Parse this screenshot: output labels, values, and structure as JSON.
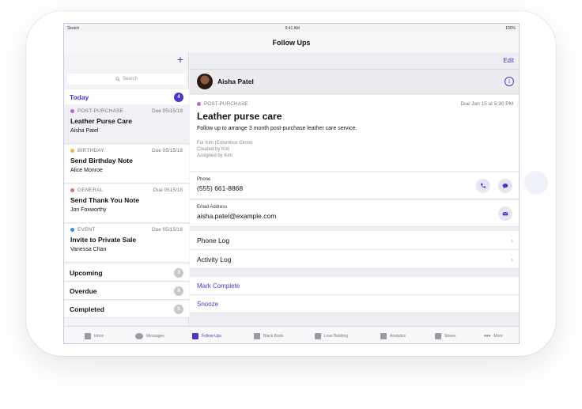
{
  "status_bar": {
    "carrier": "Sketch",
    "time": "9:41 AM",
    "battery": "100%"
  },
  "nav": {
    "title": "Follow Ups",
    "edit": "Edit",
    "add": "+"
  },
  "search": {
    "placeholder": "Search"
  },
  "today": {
    "label": "Today",
    "count": "4"
  },
  "items": [
    {
      "category": "POST-PURCHASE",
      "due": "Due 05/15/18",
      "title": "Leather Purse Care",
      "person": "Aisha Patel",
      "color": "#b06ad8"
    },
    {
      "category": "BIRTHDAY",
      "due": "Due 05/15/18",
      "title": "Send Birthday Note",
      "person": "Alice Monroe",
      "color": "#f0b73a"
    },
    {
      "category": "GENERAL",
      "due": "Due 0515/18",
      "title": "Send Thank You Note",
      "person": "Jon Foxworthy",
      "color": "#e07070"
    },
    {
      "category": "EVENT",
      "due": "Due 05/15/18",
      "title": "Invite to Private Sale",
      "person": "Vanessa Chan",
      "color": "#3a8ae0"
    }
  ],
  "groups": [
    {
      "label": "Upcoming",
      "count": "3"
    },
    {
      "label": "Overdue",
      "count": "6"
    },
    {
      "label": "Completed",
      "count": "5"
    }
  ],
  "detail": {
    "name": "Aisha Patel",
    "category": "POST-PURCHASE",
    "due": "Due Jan 15 at 5:30 PM",
    "title": "Leather purse care",
    "description": "Follow up to arrange 3 month post-purchase leather care service.",
    "for": "For Kim (Columbus Circle)",
    "created": "Created by Kim",
    "assigned": "Assigned by Kim"
  },
  "contact": {
    "phone_label": "Phone",
    "phone": "(555) 661-8868",
    "email_label": "Email Address",
    "email": "aisha.patel@example.com"
  },
  "logs": {
    "phone_log": "Phone Log",
    "activity_log": "Activity Log"
  },
  "actions": {
    "mark_complete": "Mark Complete",
    "snooze": "Snooze"
  },
  "tabs": {
    "inbox": "Inbox",
    "messages": "Messages",
    "follow_ups": "Follow-Ups",
    "black_book": "Black Book",
    "love_building": "Love Building",
    "analytics": "Analytics",
    "stores": "Stores",
    "more": "More"
  },
  "colors": {
    "accent": "#4a37c9"
  }
}
